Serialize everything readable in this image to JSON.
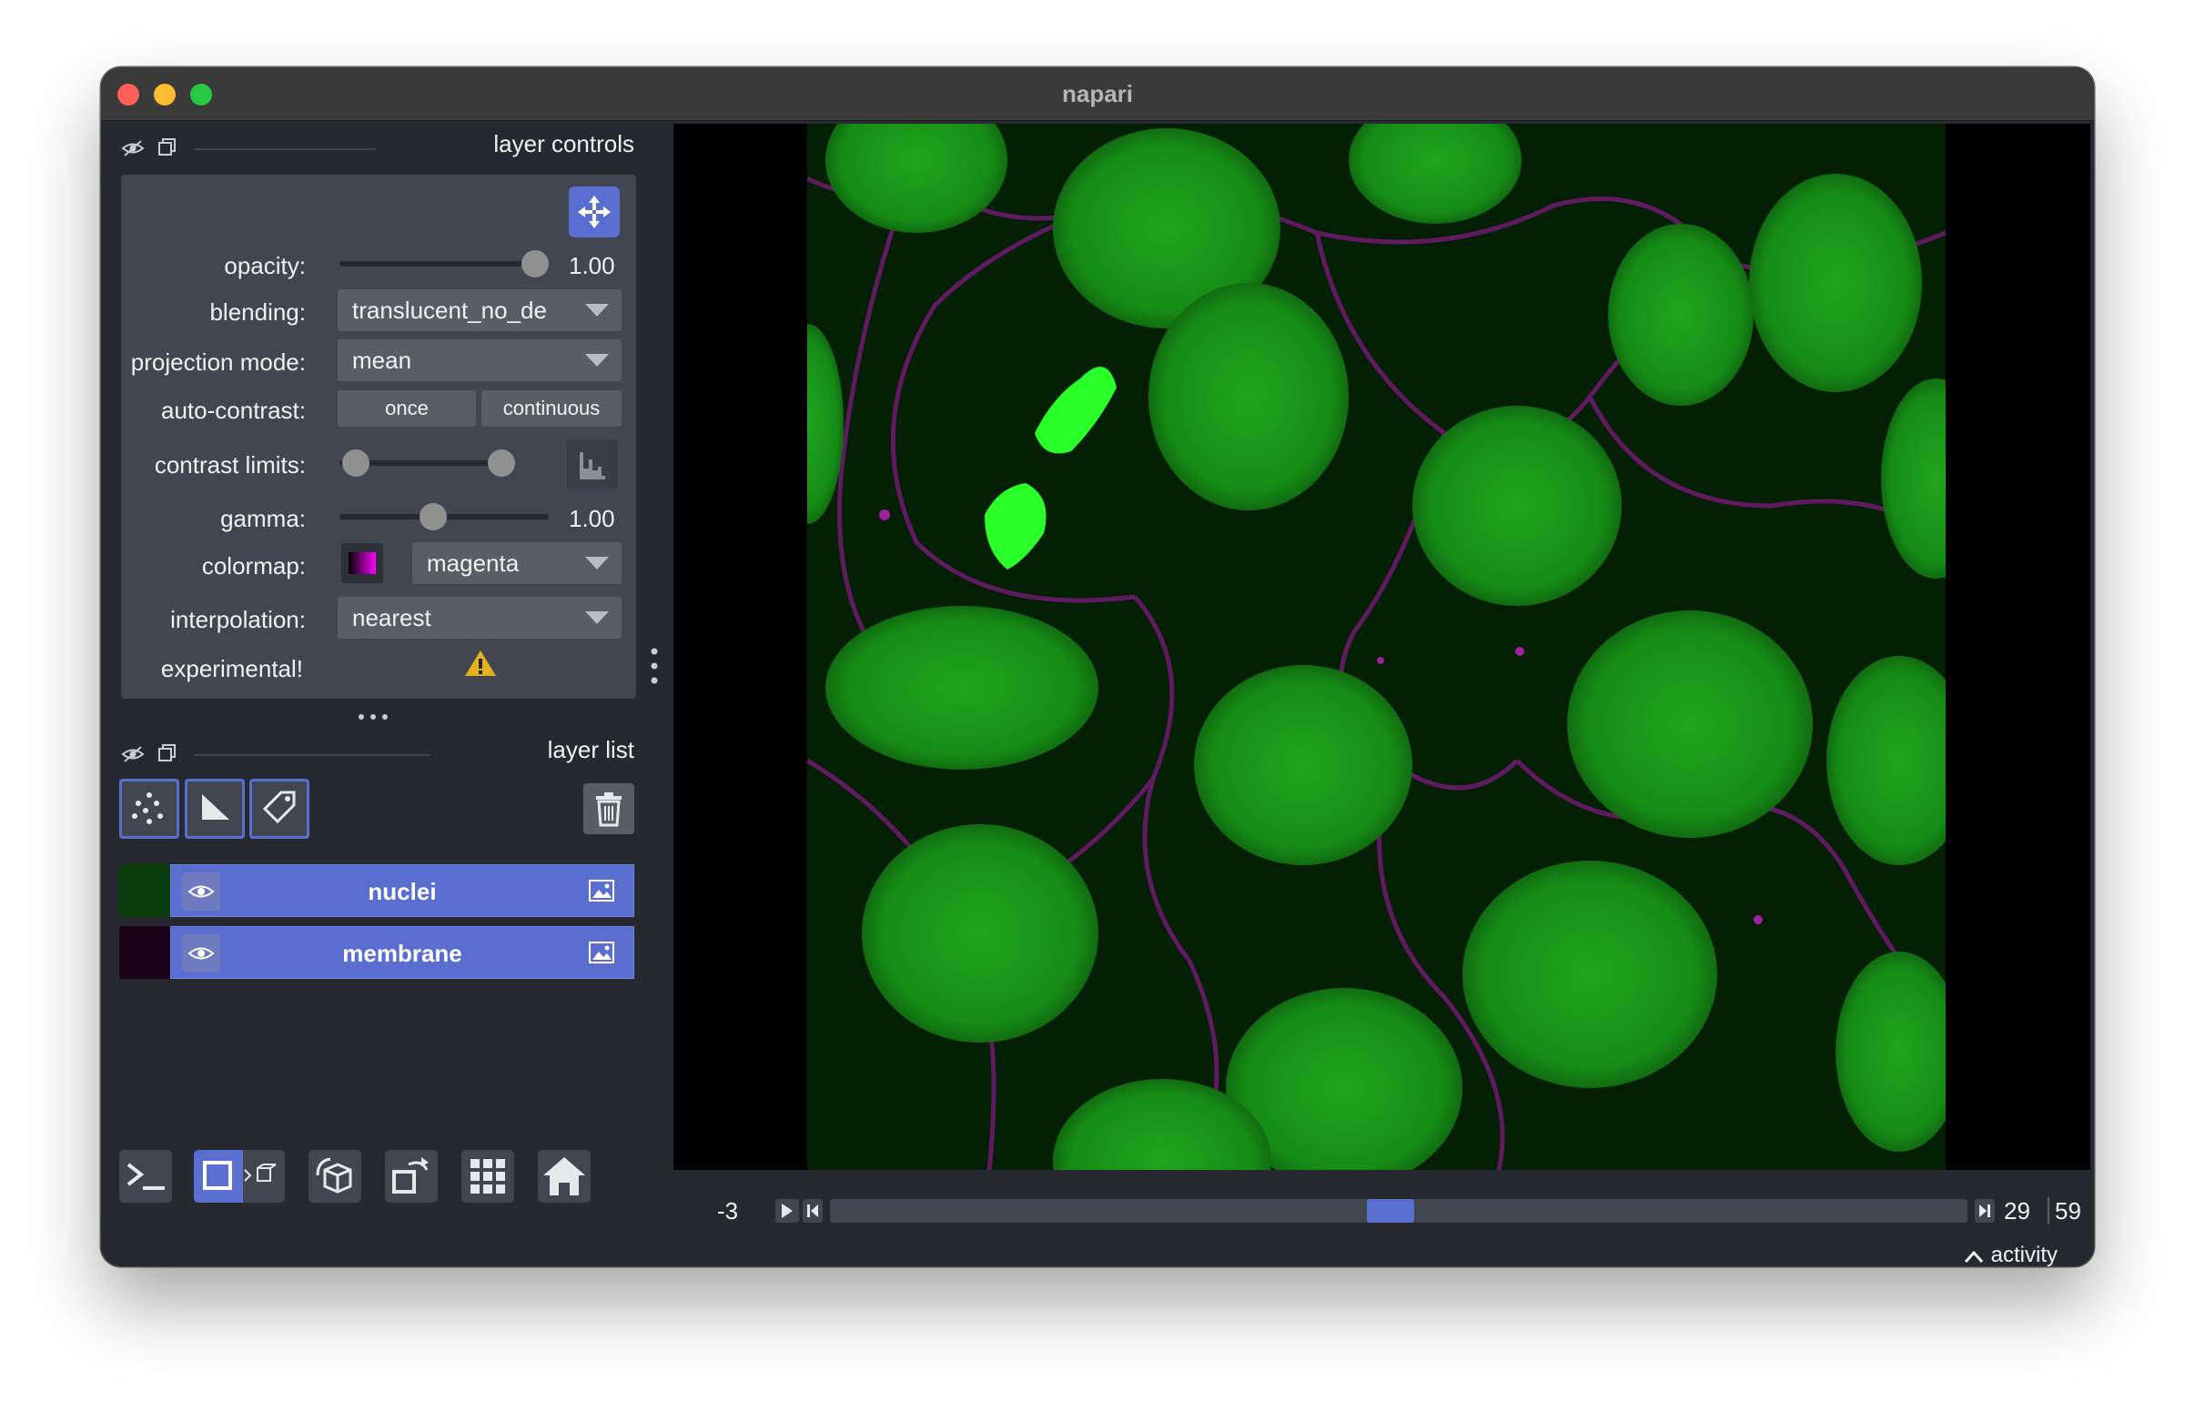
{
  "window": {
    "title": "napari"
  },
  "layer_controls": {
    "header_title": "layer controls",
    "opacity": {
      "label": "opacity:",
      "value": "1.00",
      "level": 1.0
    },
    "blending": {
      "label": "blending:",
      "value": "translucent_no_de"
    },
    "projection_mode": {
      "label": "projection mode:",
      "value": "mean"
    },
    "auto_contrast": {
      "label": "auto-contrast:",
      "once": "once",
      "continuous": "continuous"
    },
    "contrast_limits": {
      "label": "contrast limits:"
    },
    "gamma": {
      "label": "gamma:",
      "value": "1.00"
    },
    "colormap": {
      "label": "colormap:",
      "value": "magenta"
    },
    "interpolation": {
      "label": "interpolation:",
      "value": "nearest"
    },
    "experimental": {
      "label": "experimental!"
    }
  },
  "layer_list": {
    "header_title": "layer list",
    "layers": [
      {
        "name": "nuclei",
        "thumb_color": "#0c3d0c"
      },
      {
        "name": "membrane",
        "thumb_color": "#1a0318"
      }
    ]
  },
  "dims": {
    "axis_label": "-3",
    "current": "29",
    "total": "59"
  },
  "status": {
    "activity": "activity"
  },
  "colors": {
    "background": "#262930",
    "panel": "#414651",
    "accent": "#5a6ed0",
    "nuclei": "#22c822",
    "membrane": "#b020b0"
  },
  "icons": {
    "header": [
      "eye-closed-icon",
      "copy-icon"
    ],
    "layer_buttons": [
      "points-icon",
      "shapes-icon",
      "labels-icon",
      "trash-icon"
    ],
    "bottom": [
      "console-icon",
      "ndisplay-icon",
      "3d-cube-icon",
      "transpose-icon",
      "grid-icon",
      "home-icon"
    ]
  }
}
